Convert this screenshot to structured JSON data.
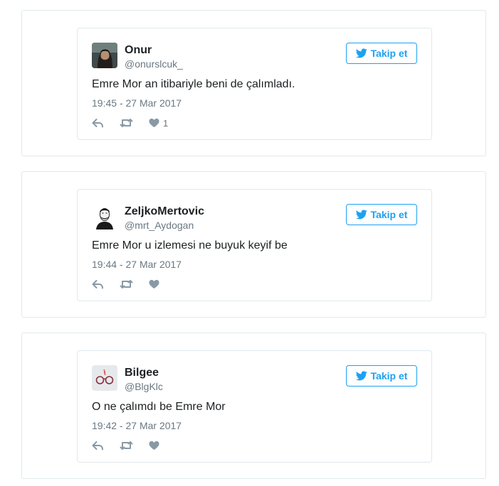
{
  "colors": {
    "accent": "#1da1f2",
    "border": "#e1e8ed",
    "muted": "#697882",
    "icon": "#8899a6"
  },
  "tweets": [
    {
      "name": "Onur",
      "handle": "@onurslcuk_",
      "follow_label": "Takip et",
      "text": "Emre Mor an itibariyle beni de çalımladı.",
      "time": "19:45 - 27 Mar 2017",
      "like_count": "1",
      "avatar_icon": "avatar-photo-icon"
    },
    {
      "name": "ZeljkoMertovic",
      "handle": "@mrt_Aydogan",
      "follow_label": "Takip et",
      "text": "Emre Mor u izlemesi ne buyuk keyif be",
      "time": "19:44 - 27 Mar 2017",
      "like_count": "",
      "avatar_icon": "avatar-sketch-icon"
    },
    {
      "name": "Bilgee",
      "handle": "@BlgKlc",
      "follow_label": "Takip et",
      "text": "O ne çalımdı be Emre Mor",
      "time": "19:42 - 27 Mar 2017",
      "like_count": "",
      "avatar_icon": "avatar-glasses-icon"
    }
  ]
}
